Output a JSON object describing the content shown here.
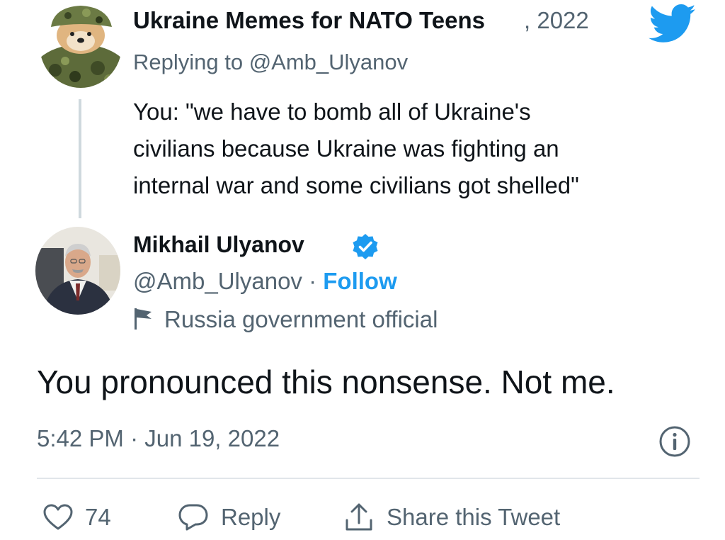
{
  "reply_tweet": {
    "author_name": "Ukraine Memes for NATO Teens",
    "date": ", 2022",
    "replying_to": "Replying to @Amb_Ulyanov",
    "text_lines": [
      "You: \"we have to bomb all of Ukraine's",
      "civilians because Ukraine was fighting an",
      "internal war and some civilians got shelled\""
    ]
  },
  "main_tweet": {
    "author_name": "Mikhail Ulyanov",
    "handle": "@Amb_Ulyanov",
    "separator": " · ",
    "follow_label": "Follow",
    "label": "Russia government official",
    "text": "You pronounced this nonsense. Not me.",
    "timestamp": "5:42 PM · Jun 19, 2022"
  },
  "actions": {
    "like_count": "74",
    "reply_label": "Reply",
    "share_label": "Share this Tweet"
  },
  "icons": [
    "twitter-bird-icon",
    "verified-badge-icon",
    "government-flag-icon",
    "info-icon",
    "heart-icon",
    "reply-bubble-icon",
    "share-icon"
  ],
  "colors": {
    "accent": "#1d9bf0",
    "muted": "#536471",
    "text": "#0f1419",
    "divider": "#e1e6ea"
  }
}
